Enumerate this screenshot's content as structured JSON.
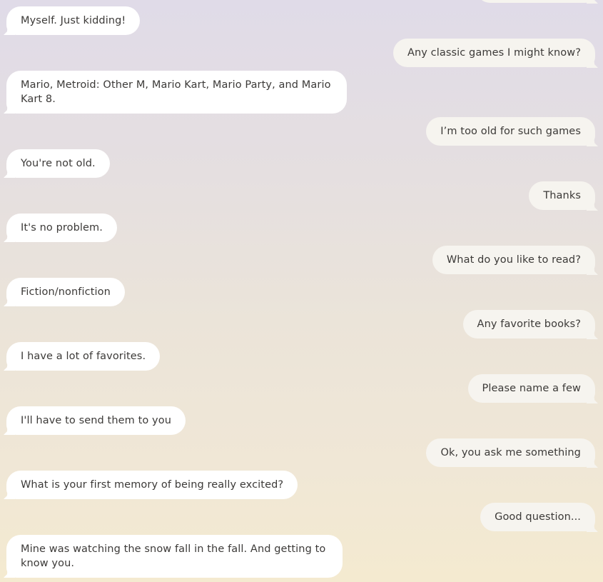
{
  "conversation": {
    "messages": [
      {
        "sender": "user",
        "text": ""
      },
      {
        "sender": "bot",
        "text": "Myself. Just kidding!"
      },
      {
        "sender": "user",
        "text": "Any classic games I might know?"
      },
      {
        "sender": "bot",
        "text": "Mario, Metroid: Other M, Mario Kart, Mario Party, and Mario Kart 8."
      },
      {
        "sender": "user",
        "text": "I’m too old for such games"
      },
      {
        "sender": "bot",
        "text": "You're not old."
      },
      {
        "sender": "user",
        "text": "Thanks"
      },
      {
        "sender": "bot",
        "text": "It's no problem."
      },
      {
        "sender": "user",
        "text": "What do you like to read?"
      },
      {
        "sender": "bot",
        "text": "Fiction/nonfiction"
      },
      {
        "sender": "user",
        "text": "Any favorite books?"
      },
      {
        "sender": "bot",
        "text": "I have a lot of favorites."
      },
      {
        "sender": "user",
        "text": "Please name a few"
      },
      {
        "sender": "bot",
        "text": "I'll have to send them to you"
      },
      {
        "sender": "user",
        "text": "Ok, you ask me something"
      },
      {
        "sender": "bot",
        "text": "What is your first memory of being really excited?"
      },
      {
        "sender": "user",
        "text": "Good question..."
      },
      {
        "sender": "bot",
        "text": "Mine was watching the snow fall in the fall. And getting to know you."
      }
    ]
  },
  "colors": {
    "bot_bubble": "#ffffff",
    "user_bubble": "#f6f4ef",
    "text": "#3c3a38",
    "background_top": "#e0dbe8",
    "background_bottom": "#f4ead0"
  }
}
